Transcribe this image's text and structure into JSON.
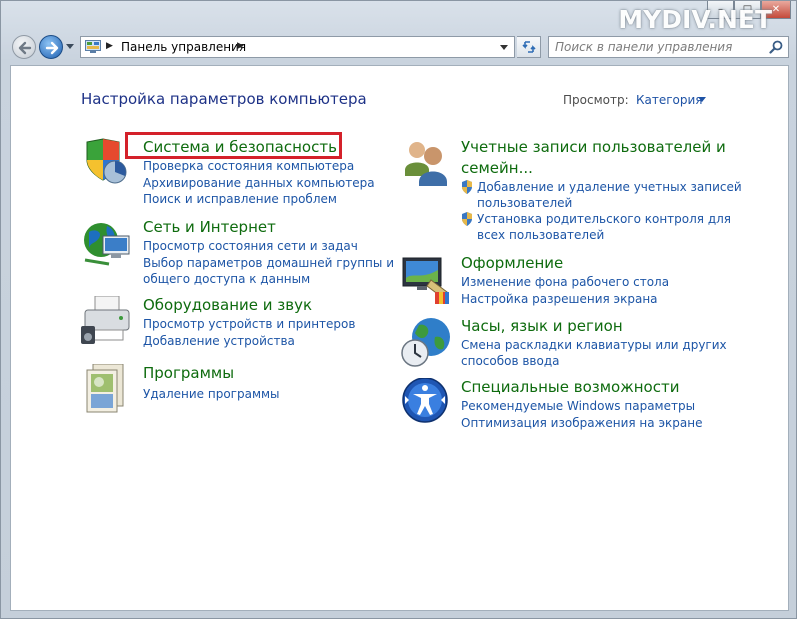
{
  "window": {
    "minimize_label": "–",
    "maximize_label": "□",
    "close_label": "✕",
    "watermark": "MYDIV.NET"
  },
  "nav": {
    "back_icon": "back-arrow-icon",
    "forward_icon": "forward-arrow-icon",
    "breadcrumb": [
      "Панель управления"
    ],
    "refresh_icon": "refresh-icon",
    "search_placeholder": "Поиск в панели управления",
    "search_value": ""
  },
  "content": {
    "page_title": "Настройка параметров компьютера",
    "view_label": "Просмотр:",
    "view_value": "Категория"
  },
  "left_categories": [
    {
      "title": "Система и безопасность",
      "icon": "system-security-icon",
      "links": [
        "Проверка состояния компьютера",
        "Архивирование данных компьютера",
        "Поиск и исправление проблем"
      ]
    },
    {
      "title": "Сеть и Интернет",
      "icon": "network-internet-icon",
      "links": [
        "Просмотр состояния сети и задач",
        "Выбор параметров домашней группы и",
        "общего доступа к данным"
      ]
    },
    {
      "title": "Оборудование и звук",
      "icon": "hardware-sound-icon",
      "links": [
        "Просмотр устройств и принтеров",
        "Добавление устройства"
      ]
    },
    {
      "title": "Программы",
      "icon": "programs-icon",
      "links": [
        "Удаление программы"
      ]
    }
  ],
  "right_categories": [
    {
      "title_lines": [
        "Учетные записи пользователей и",
        "семейн..."
      ],
      "icon": "user-accounts-icon",
      "links": [
        "Добавление и удаление учетных записей",
        "пользователей",
        "Установка родительского контроля для",
        "всех пользователей"
      ]
    },
    {
      "title_lines": [
        "Оформление"
      ],
      "icon": "appearance-icon",
      "links": [
        "Изменение фона рабочего стола",
        "Настройка разрешения экрана"
      ]
    },
    {
      "title_lines": [
        "Часы, язык и регион"
      ],
      "icon": "clock-language-region-icon",
      "links": [
        "Смена раскладки клавиатуры или других",
        "способов ввода"
      ]
    },
    {
      "title_lines": [
        "Специальные возможности"
      ],
      "icon": "ease-of-access-icon",
      "links": [
        "Рекомендуемые Windows параметры",
        "Оптимизация изображения на экране"
      ]
    }
  ],
  "colors": {
    "category_title": "#0e6b0e",
    "link": "#1d55a6",
    "highlight": "#d4212a"
  }
}
